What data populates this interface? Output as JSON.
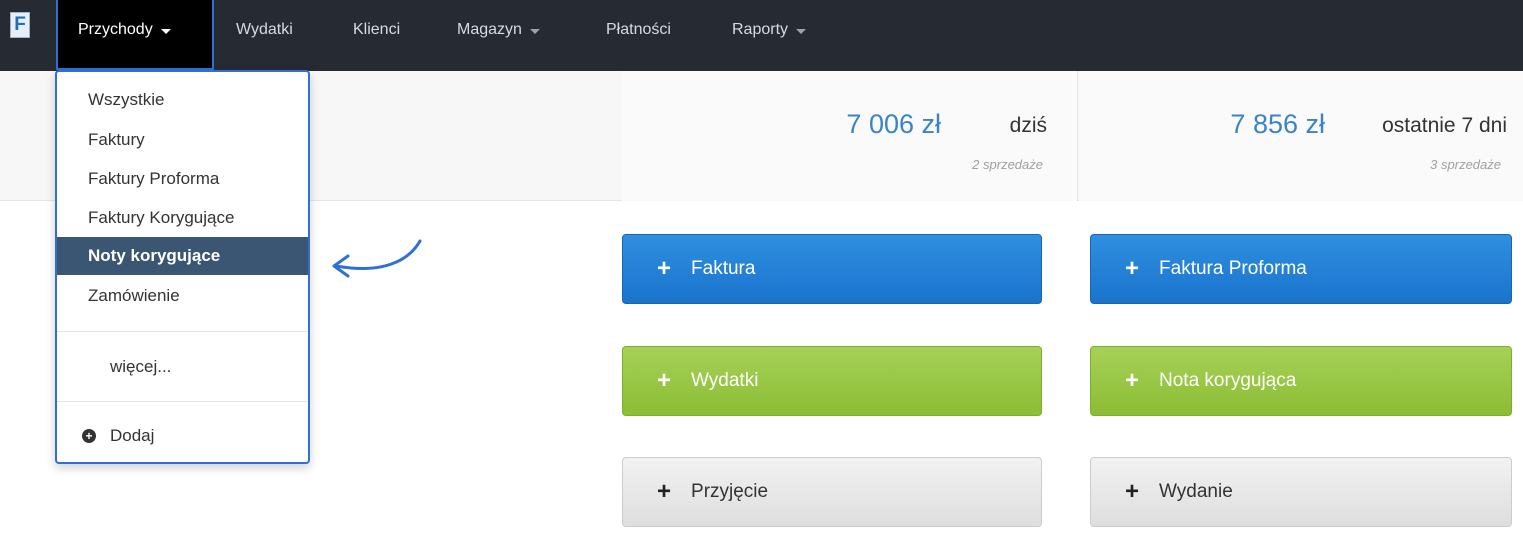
{
  "navbar": {
    "logo_letter": "F",
    "items": [
      {
        "label": "Przychody",
        "has_caret": true,
        "active": true
      },
      {
        "label": "Wydatki",
        "has_caret": false
      },
      {
        "label": "Klienci",
        "has_caret": false
      },
      {
        "label": "Magazyn",
        "has_caret": true
      },
      {
        "label": "Płatności",
        "has_caret": false
      },
      {
        "label": "Raporty",
        "has_caret": true
      }
    ]
  },
  "dropdown": {
    "items": [
      {
        "label": "Wszystkie"
      },
      {
        "label": "Faktury"
      },
      {
        "label": "Faktury Proforma"
      },
      {
        "label": "Faktury Korygujące"
      },
      {
        "label": "Noty korygujące",
        "active": true
      },
      {
        "label": "Zamówienie"
      }
    ],
    "more_label": "więcej...",
    "add_label": "Dodaj"
  },
  "stats": [
    {
      "amount": "7 006 zł",
      "period": "dziś",
      "sales": "2 sprzedaże"
    },
    {
      "amount": "7 856 zł",
      "period": "ostatnie 7 dni",
      "sales": "3 sprzedaże"
    }
  ],
  "buttons": {
    "faktura": "Faktura",
    "faktura_proforma": "Faktura Proforma",
    "wydatki": "Wydatki",
    "nota_korygujaca": "Nota korygująca",
    "przyjecie": "Przyjęcie",
    "wydanie": "Wydanie"
  },
  "colors": {
    "navbar_bg": "#262b33",
    "accent_blue": "#1a74cc",
    "accent_green": "#8cbd35",
    "active_item_bg": "#3b5673",
    "stat_amount": "#3a83c9"
  }
}
